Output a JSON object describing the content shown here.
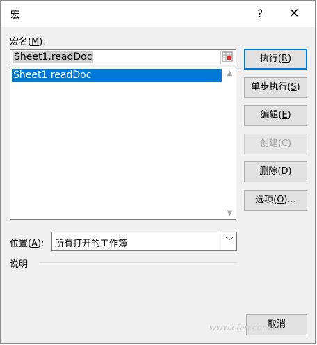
{
  "window": {
    "title": "宏",
    "help_label": "?",
    "close_label": "✕"
  },
  "macro_name": {
    "label_prefix": "宏名(",
    "label_accel": "M",
    "label_suffix": "):",
    "value": "Sheet1.readDoc",
    "picker_icon": "range-picker-icon"
  },
  "macro_list": {
    "items": [
      "Sheet1.readDoc"
    ],
    "selected_index": 0
  },
  "buttons": {
    "run": {
      "prefix": "执行(",
      "accel": "R",
      "suffix": ")"
    },
    "step": {
      "prefix": "单步执行(",
      "accel": "S",
      "suffix": ")"
    },
    "edit": {
      "prefix": "编辑(",
      "accel": "E",
      "suffix": ")"
    },
    "create": {
      "prefix": "创建(",
      "accel": "C",
      "suffix": ")"
    },
    "delete": {
      "prefix": "删除(",
      "accel": "D",
      "suffix": ")"
    },
    "options": {
      "prefix": "选项(",
      "accel": "O",
      "suffix": ")..."
    },
    "cancel": {
      "label": "取消"
    }
  },
  "location": {
    "label_prefix": "位置(",
    "label_accel": "A",
    "label_suffix": "):",
    "value": "所有打开的工作簿"
  },
  "description": {
    "label": "说明"
  },
  "watermark": "www.cfan.com.cn",
  "colors": {
    "selection": "#0078d7",
    "default_button_border": "#0078d7",
    "disabled_text": "#a0a0a0"
  }
}
